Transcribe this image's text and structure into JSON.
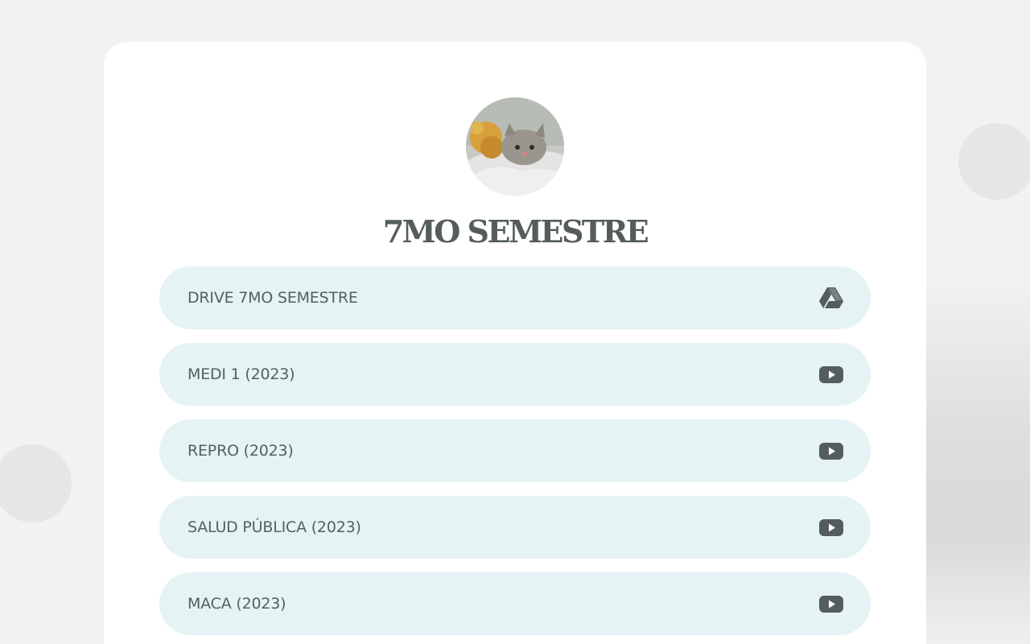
{
  "page": {
    "title": "7MO SEMESTRE",
    "avatar_icon": "cat-avatar-photo"
  },
  "links": [
    {
      "label": "DRIVE 7MO SEMESTRE",
      "icon": "google-drive-icon"
    },
    {
      "label": "MEDI 1 (2023)",
      "icon": "youtube-icon"
    },
    {
      "label": "REPRO (2023)",
      "icon": "youtube-icon"
    },
    {
      "label": "SALUD PÚBLICA (2023)",
      "icon": "youtube-icon"
    },
    {
      "label": "MACA (2023)",
      "icon": "youtube-icon"
    }
  ],
  "colors": {
    "background": "#f2f2f2",
    "card": "#ffffff",
    "button": "#e5f3f5",
    "text": "#55605f",
    "icon": "#545d5c"
  }
}
